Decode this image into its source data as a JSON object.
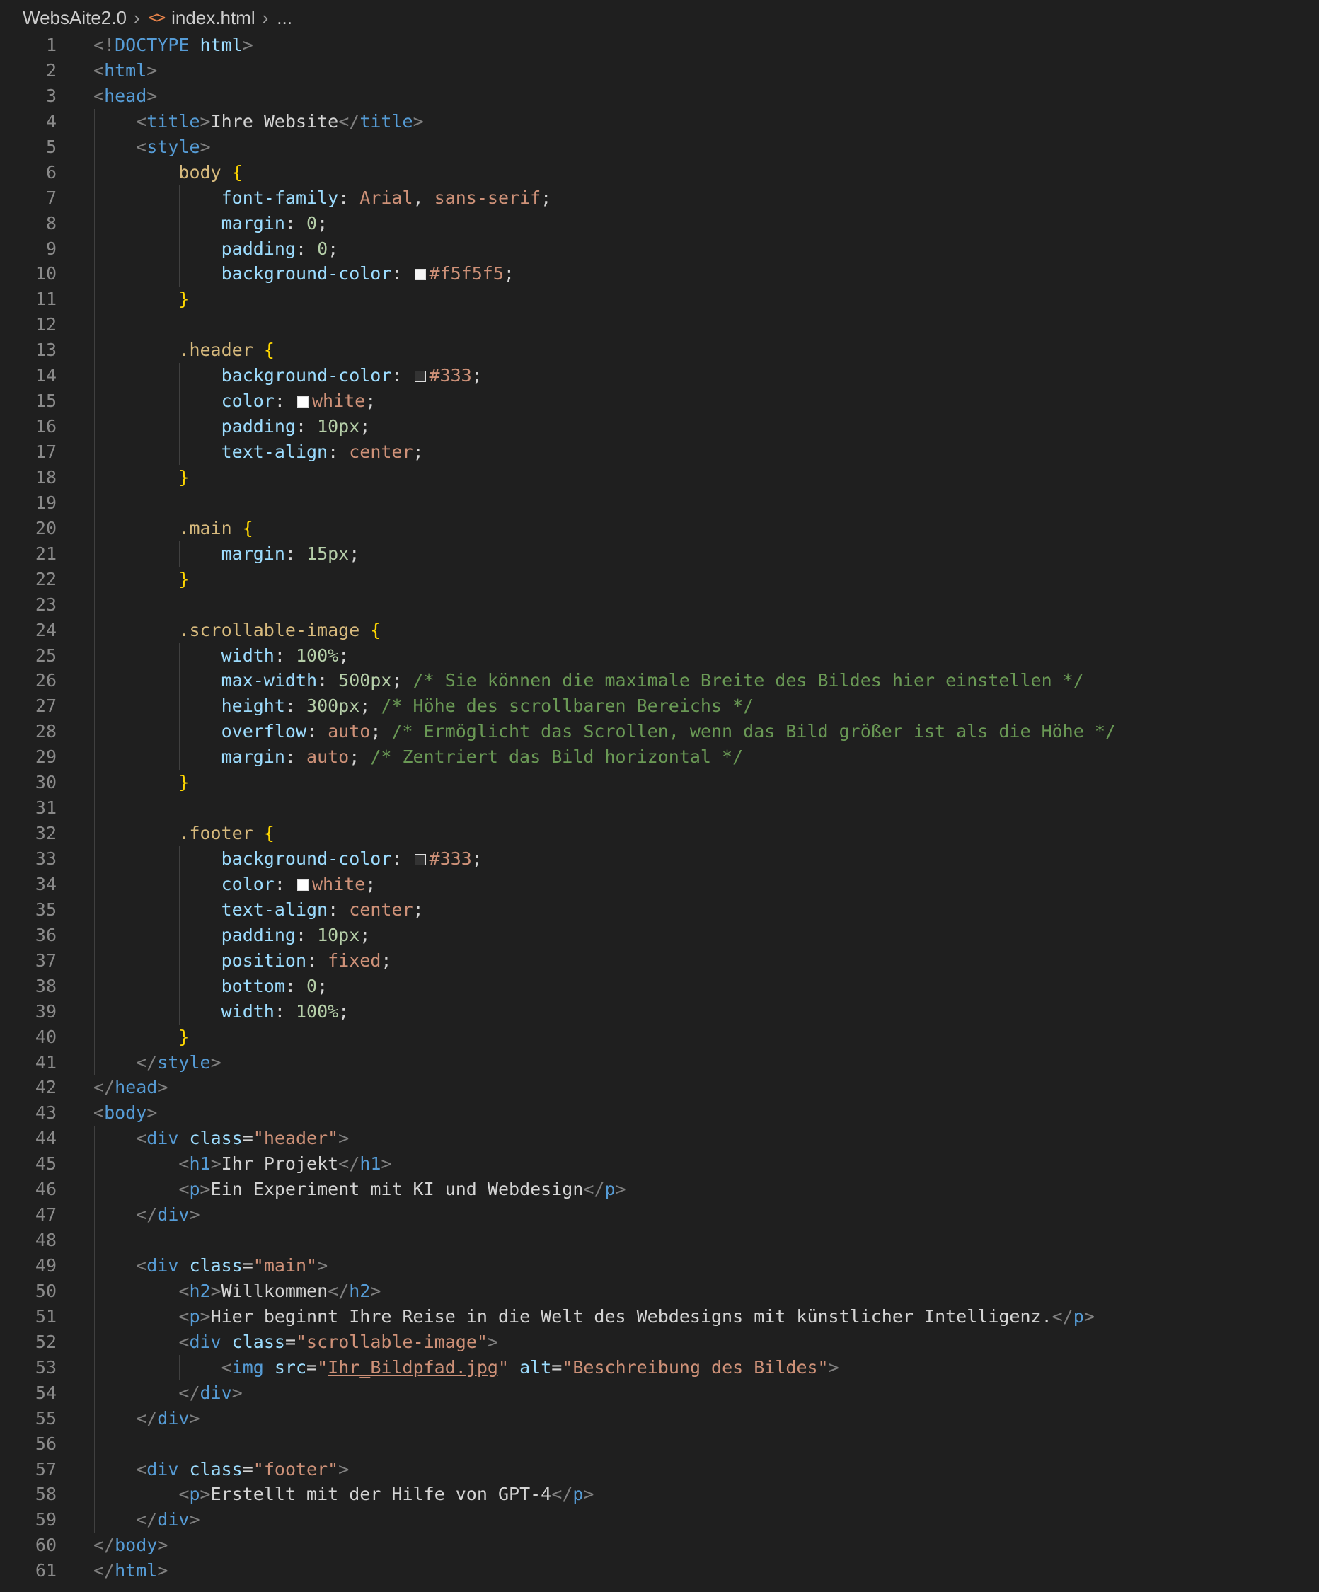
{
  "breadcrumb": {
    "folder": "WebsAite2.0",
    "file": "index.html",
    "more": "...",
    "file_icon": "html-brackets-icon"
  },
  "colors": {
    "background": "#1f1f1f",
    "tag": "#569cd6",
    "attribute": "#9cdcfe",
    "string": "#ce9178",
    "selector": "#d7ba7d",
    "brace": "#ffd700",
    "number": "#b5cea8",
    "comment": "#6a9955",
    "punctuation": "#808080",
    "line_number": "#8a8a8a"
  },
  "lines": [
    {
      "n": "1",
      "indent": 0,
      "tokens": [
        [
          "p",
          "<!"
        ],
        [
          "t",
          "DOCTYPE"
        ],
        [
          "x",
          " "
        ],
        [
          "a",
          "html"
        ],
        [
          "p",
          ">"
        ]
      ]
    },
    {
      "n": "2",
      "indent": 0,
      "tokens": [
        [
          "p",
          "<"
        ],
        [
          "t",
          "html"
        ],
        [
          "p",
          ">"
        ]
      ]
    },
    {
      "n": "3",
      "indent": 0,
      "tokens": [
        [
          "p",
          "<"
        ],
        [
          "t",
          "head"
        ],
        [
          "p",
          ">"
        ]
      ]
    },
    {
      "n": "4",
      "indent": 1,
      "tokens": [
        [
          "p",
          "<"
        ],
        [
          "t",
          "title"
        ],
        [
          "p",
          ">"
        ],
        [
          "x",
          "Ihre Website"
        ],
        [
          "p",
          "</"
        ],
        [
          "t",
          "title"
        ],
        [
          "p",
          ">"
        ]
      ]
    },
    {
      "n": "5",
      "indent": 1,
      "tokens": [
        [
          "p",
          "<"
        ],
        [
          "t",
          "style"
        ],
        [
          "p",
          ">"
        ]
      ]
    },
    {
      "n": "6",
      "indent": 2,
      "tokens": [
        [
          "s",
          "body"
        ],
        [
          "x",
          " "
        ],
        [
          "b",
          "{"
        ]
      ]
    },
    {
      "n": "7",
      "indent": 3,
      "tokens": [
        [
          "k",
          "font-family"
        ],
        [
          "x",
          ": "
        ],
        [
          "v",
          "Arial"
        ],
        [
          "x",
          ", "
        ],
        [
          "v",
          "sans-serif"
        ],
        [
          "x",
          ";"
        ]
      ]
    },
    {
      "n": "8",
      "indent": 3,
      "tokens": [
        [
          "k",
          "margin"
        ],
        [
          "x",
          ": "
        ],
        [
          "m",
          "0"
        ],
        [
          "x",
          ";"
        ]
      ]
    },
    {
      "n": "9",
      "indent": 3,
      "tokens": [
        [
          "k",
          "padding"
        ],
        [
          "x",
          ": "
        ],
        [
          "m",
          "0"
        ],
        [
          "x",
          ";"
        ]
      ]
    },
    {
      "n": "10",
      "indent": 3,
      "tokens": [
        [
          "k",
          "background-color"
        ],
        [
          "x",
          ": "
        ],
        [
          "sw",
          "#f5f5f5"
        ],
        [
          "v",
          "#f5f5f5"
        ],
        [
          "x",
          ";"
        ]
      ]
    },
    {
      "n": "11",
      "indent": 2,
      "tokens": [
        [
          "b",
          "}"
        ]
      ]
    },
    {
      "n": "12",
      "indent": 2,
      "tokens": []
    },
    {
      "n": "13",
      "indent": 2,
      "tokens": [
        [
          "s",
          ".header"
        ],
        [
          "x",
          " "
        ],
        [
          "b",
          "{"
        ]
      ]
    },
    {
      "n": "14",
      "indent": 3,
      "tokens": [
        [
          "k",
          "background-color"
        ],
        [
          "x",
          ": "
        ],
        [
          "sw",
          "#333333"
        ],
        [
          "v",
          "#333"
        ],
        [
          "x",
          ";"
        ]
      ]
    },
    {
      "n": "15",
      "indent": 3,
      "tokens": [
        [
          "k",
          "color"
        ],
        [
          "x",
          ": "
        ],
        [
          "sw",
          "#ffffff"
        ],
        [
          "v",
          "white"
        ],
        [
          "x",
          ";"
        ]
      ]
    },
    {
      "n": "16",
      "indent": 3,
      "tokens": [
        [
          "k",
          "padding"
        ],
        [
          "x",
          ": "
        ],
        [
          "m",
          "10px"
        ],
        [
          "x",
          ";"
        ]
      ]
    },
    {
      "n": "17",
      "indent": 3,
      "tokens": [
        [
          "k",
          "text-align"
        ],
        [
          "x",
          ": "
        ],
        [
          "v",
          "center"
        ],
        [
          "x",
          ";"
        ]
      ]
    },
    {
      "n": "18",
      "indent": 2,
      "tokens": [
        [
          "b",
          "}"
        ]
      ]
    },
    {
      "n": "19",
      "indent": 2,
      "tokens": []
    },
    {
      "n": "20",
      "indent": 2,
      "tokens": [
        [
          "s",
          ".main"
        ],
        [
          "x",
          " "
        ],
        [
          "b",
          "{"
        ]
      ]
    },
    {
      "n": "21",
      "indent": 3,
      "tokens": [
        [
          "k",
          "margin"
        ],
        [
          "x",
          ": "
        ],
        [
          "m",
          "15px"
        ],
        [
          "x",
          ";"
        ]
      ]
    },
    {
      "n": "22",
      "indent": 2,
      "tokens": [
        [
          "b",
          "}"
        ]
      ]
    },
    {
      "n": "23",
      "indent": 2,
      "tokens": []
    },
    {
      "n": "24",
      "indent": 2,
      "tokens": [
        [
          "s",
          ".scrollable-image"
        ],
        [
          "x",
          " "
        ],
        [
          "b",
          "{"
        ]
      ]
    },
    {
      "n": "25",
      "indent": 3,
      "tokens": [
        [
          "k",
          "width"
        ],
        [
          "x",
          ": "
        ],
        [
          "m",
          "100%"
        ],
        [
          "x",
          ";"
        ]
      ]
    },
    {
      "n": "26",
      "indent": 3,
      "tokens": [
        [
          "k",
          "max-width"
        ],
        [
          "x",
          ": "
        ],
        [
          "m",
          "500px"
        ],
        [
          "x",
          "; "
        ],
        [
          "c",
          "/* Sie können die maximale Breite des Bildes hier einstellen */"
        ]
      ]
    },
    {
      "n": "27",
      "indent": 3,
      "tokens": [
        [
          "k",
          "height"
        ],
        [
          "x",
          ": "
        ],
        [
          "m",
          "300px"
        ],
        [
          "x",
          "; "
        ],
        [
          "c",
          "/* Höhe des scrollbaren Bereichs */"
        ]
      ]
    },
    {
      "n": "28",
      "indent": 3,
      "tokens": [
        [
          "k",
          "overflow"
        ],
        [
          "x",
          ": "
        ],
        [
          "v",
          "auto"
        ],
        [
          "x",
          "; "
        ],
        [
          "c",
          "/* Ermöglicht das Scrollen, wenn das Bild größer ist als die Höhe */"
        ]
      ]
    },
    {
      "n": "29",
      "indent": 3,
      "tokens": [
        [
          "k",
          "margin"
        ],
        [
          "x",
          ": "
        ],
        [
          "v",
          "auto"
        ],
        [
          "x",
          "; "
        ],
        [
          "c",
          "/* Zentriert das Bild horizontal */"
        ]
      ]
    },
    {
      "n": "30",
      "indent": 2,
      "tokens": [
        [
          "b",
          "}"
        ]
      ]
    },
    {
      "n": "31",
      "indent": 2,
      "tokens": []
    },
    {
      "n": "32",
      "indent": 2,
      "tokens": [
        [
          "s",
          ".footer"
        ],
        [
          "x",
          " "
        ],
        [
          "b",
          "{"
        ]
      ]
    },
    {
      "n": "33",
      "indent": 3,
      "tokens": [
        [
          "k",
          "background-color"
        ],
        [
          "x",
          ": "
        ],
        [
          "sw",
          "#333333"
        ],
        [
          "v",
          "#333"
        ],
        [
          "x",
          ";"
        ]
      ]
    },
    {
      "n": "34",
      "indent": 3,
      "tokens": [
        [
          "k",
          "color"
        ],
        [
          "x",
          ": "
        ],
        [
          "sw",
          "#ffffff"
        ],
        [
          "v",
          "white"
        ],
        [
          "x",
          ";"
        ]
      ]
    },
    {
      "n": "35",
      "indent": 3,
      "tokens": [
        [
          "k",
          "text-align"
        ],
        [
          "x",
          ": "
        ],
        [
          "v",
          "center"
        ],
        [
          "x",
          ";"
        ]
      ]
    },
    {
      "n": "36",
      "indent": 3,
      "tokens": [
        [
          "k",
          "padding"
        ],
        [
          "x",
          ": "
        ],
        [
          "m",
          "10px"
        ],
        [
          "x",
          ";"
        ]
      ]
    },
    {
      "n": "37",
      "indent": 3,
      "tokens": [
        [
          "k",
          "position"
        ],
        [
          "x",
          ": "
        ],
        [
          "v",
          "fixed"
        ],
        [
          "x",
          ";"
        ]
      ]
    },
    {
      "n": "38",
      "indent": 3,
      "tokens": [
        [
          "k",
          "bottom"
        ],
        [
          "x",
          ": "
        ],
        [
          "m",
          "0"
        ],
        [
          "x",
          ";"
        ]
      ]
    },
    {
      "n": "39",
      "indent": 3,
      "tokens": [
        [
          "k",
          "width"
        ],
        [
          "x",
          ": "
        ],
        [
          "m",
          "100%"
        ],
        [
          "x",
          ";"
        ]
      ]
    },
    {
      "n": "40",
      "indent": 2,
      "tokens": [
        [
          "b",
          "}"
        ]
      ]
    },
    {
      "n": "41",
      "indent": 1,
      "tokens": [
        [
          "p",
          "</"
        ],
        [
          "t",
          "style"
        ],
        [
          "p",
          ">"
        ]
      ]
    },
    {
      "n": "42",
      "indent": 0,
      "tokens": [
        [
          "p",
          "</"
        ],
        [
          "t",
          "head"
        ],
        [
          "p",
          ">"
        ]
      ]
    },
    {
      "n": "43",
      "indent": 0,
      "tokens": [
        [
          "p",
          "<"
        ],
        [
          "t",
          "body"
        ],
        [
          "p",
          ">"
        ]
      ]
    },
    {
      "n": "44",
      "indent": 1,
      "tokens": [
        [
          "p",
          "<"
        ],
        [
          "t",
          "div"
        ],
        [
          "x",
          " "
        ],
        [
          "a",
          "class"
        ],
        [
          "x",
          "="
        ],
        [
          "st",
          "\"header\""
        ],
        [
          "p",
          ">"
        ]
      ]
    },
    {
      "n": "45",
      "indent": 2,
      "tokens": [
        [
          "p",
          "<"
        ],
        [
          "t",
          "h1"
        ],
        [
          "p",
          ">"
        ],
        [
          "x",
          "Ihr Projekt"
        ],
        [
          "p",
          "</"
        ],
        [
          "t",
          "h1"
        ],
        [
          "p",
          ">"
        ]
      ]
    },
    {
      "n": "46",
      "indent": 2,
      "tokens": [
        [
          "p",
          "<"
        ],
        [
          "t",
          "p"
        ],
        [
          "p",
          ">"
        ],
        [
          "x",
          "Ein Experiment mit KI und Webdesign"
        ],
        [
          "p",
          "</"
        ],
        [
          "t",
          "p"
        ],
        [
          "p",
          ">"
        ]
      ]
    },
    {
      "n": "47",
      "indent": 1,
      "tokens": [
        [
          "p",
          "</"
        ],
        [
          "t",
          "div"
        ],
        [
          "p",
          ">"
        ]
      ]
    },
    {
      "n": "48",
      "indent": 1,
      "tokens": []
    },
    {
      "n": "49",
      "indent": 1,
      "tokens": [
        [
          "p",
          "<"
        ],
        [
          "t",
          "div"
        ],
        [
          "x",
          " "
        ],
        [
          "a",
          "class"
        ],
        [
          "x",
          "="
        ],
        [
          "st",
          "\"main\""
        ],
        [
          "p",
          ">"
        ]
      ]
    },
    {
      "n": "50",
      "indent": 2,
      "tokens": [
        [
          "p",
          "<"
        ],
        [
          "t",
          "h2"
        ],
        [
          "p",
          ">"
        ],
        [
          "x",
          "Willkommen"
        ],
        [
          "p",
          "</"
        ],
        [
          "t",
          "h2"
        ],
        [
          "p",
          ">"
        ]
      ]
    },
    {
      "n": "51",
      "indent": 2,
      "tokens": [
        [
          "p",
          "<"
        ],
        [
          "t",
          "p"
        ],
        [
          "p",
          ">"
        ],
        [
          "x",
          "Hier beginnt Ihre Reise in die Welt des Webdesigns mit künstlicher Intelligenz."
        ],
        [
          "p",
          "</"
        ],
        [
          "t",
          "p"
        ],
        [
          "p",
          ">"
        ]
      ]
    },
    {
      "n": "52",
      "indent": 2,
      "tokens": [
        [
          "p",
          "<"
        ],
        [
          "t",
          "div"
        ],
        [
          "x",
          " "
        ],
        [
          "a",
          "class"
        ],
        [
          "x",
          "="
        ],
        [
          "st",
          "\"scrollable-image\""
        ],
        [
          "p",
          ">"
        ]
      ]
    },
    {
      "n": "53",
      "indent": 3,
      "tokens": [
        [
          "p",
          "<"
        ],
        [
          "t",
          "img"
        ],
        [
          "x",
          " "
        ],
        [
          "a",
          "src"
        ],
        [
          "x",
          "="
        ],
        [
          "st",
          "\""
        ],
        [
          "lk",
          "Ihr_Bildpfad.jpg"
        ],
        [
          "st",
          "\""
        ],
        [
          "x",
          " "
        ],
        [
          "a",
          "alt"
        ],
        [
          "x",
          "="
        ],
        [
          "st",
          "\"Beschreibung des Bildes\""
        ],
        [
          "p",
          ">"
        ]
      ]
    },
    {
      "n": "54",
      "indent": 2,
      "tokens": [
        [
          "p",
          "</"
        ],
        [
          "t",
          "div"
        ],
        [
          "p",
          ">"
        ]
      ]
    },
    {
      "n": "55",
      "indent": 1,
      "tokens": [
        [
          "p",
          "</"
        ],
        [
          "t",
          "div"
        ],
        [
          "p",
          ">"
        ]
      ]
    },
    {
      "n": "56",
      "indent": 1,
      "tokens": []
    },
    {
      "n": "57",
      "indent": 1,
      "tokens": [
        [
          "p",
          "<"
        ],
        [
          "t",
          "div"
        ],
        [
          "x",
          " "
        ],
        [
          "a",
          "class"
        ],
        [
          "x",
          "="
        ],
        [
          "st",
          "\"footer\""
        ],
        [
          "p",
          ">"
        ]
      ]
    },
    {
      "n": "58",
      "indent": 2,
      "tokens": [
        [
          "p",
          "<"
        ],
        [
          "t",
          "p"
        ],
        [
          "p",
          ">"
        ],
        [
          "x",
          "Erstellt mit der Hilfe von GPT-4"
        ],
        [
          "p",
          "</"
        ],
        [
          "t",
          "p"
        ],
        [
          "p",
          ">"
        ]
      ]
    },
    {
      "n": "59",
      "indent": 1,
      "tokens": [
        [
          "p",
          "</"
        ],
        [
          "t",
          "div"
        ],
        [
          "p",
          ">"
        ]
      ]
    },
    {
      "n": "60",
      "indent": 0,
      "tokens": [
        [
          "p",
          "</"
        ],
        [
          "t",
          "body"
        ],
        [
          "p",
          ">"
        ]
      ]
    },
    {
      "n": "61",
      "indent": 0,
      "tokens": [
        [
          "p",
          "</"
        ],
        [
          "t",
          "html"
        ],
        [
          "p",
          ">"
        ]
      ]
    }
  ]
}
